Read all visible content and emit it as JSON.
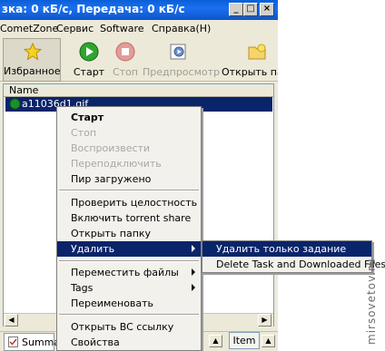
{
  "window": {
    "title": "зка: 0 кБ/с, Передача: 0 кБ/с",
    "controls": {
      "minimize": "_",
      "maximize": "□",
      "close": "×"
    }
  },
  "menubar": [
    "CometZone",
    "Сервис",
    "Software",
    "Справка(H)"
  ],
  "toolbar": {
    "favorites": "Избранное",
    "start": "Старт",
    "stop": "Стоп",
    "preview": "Предпросмотр",
    "open_folder": "Открыть па"
  },
  "list": {
    "column_name": "Name",
    "rows": [
      {
        "name": "a11036d1.gif",
        "status": "green"
      }
    ]
  },
  "context_menu": [
    {
      "label": "Старт",
      "bold": true
    },
    {
      "label": "Стоп",
      "disabled": true
    },
    {
      "label": "Воспроизвести",
      "disabled": true
    },
    {
      "label": "Переподключить",
      "disabled": true
    },
    {
      "label": "Пир загружено"
    },
    {
      "label": "Проверить целостность"
    },
    {
      "label": "Включить torrent share"
    },
    {
      "label": "Открыть папку"
    },
    {
      "label": "Удалить",
      "submenu": true,
      "highlighted": true
    },
    {
      "label": "Переместить файлы",
      "submenu": true
    },
    {
      "label": "Tags",
      "submenu": true
    },
    {
      "label": "Переименовать"
    },
    {
      "label": "Открыть BC ссылку"
    },
    {
      "label": "Свойства"
    }
  ],
  "submenu": [
    {
      "label": "Удалить только задание",
      "highlighted": true
    },
    {
      "label": "Delete Task and Downloaded Files"
    }
  ],
  "bottom": {
    "summary_tab": "Summa",
    "item_button": "Item"
  },
  "watermark": "mirsovetov.ru",
  "colors": {
    "selection": "#0a246a",
    "titlebar": "#0a5fd8",
    "status_green": "#1a8f2a"
  }
}
